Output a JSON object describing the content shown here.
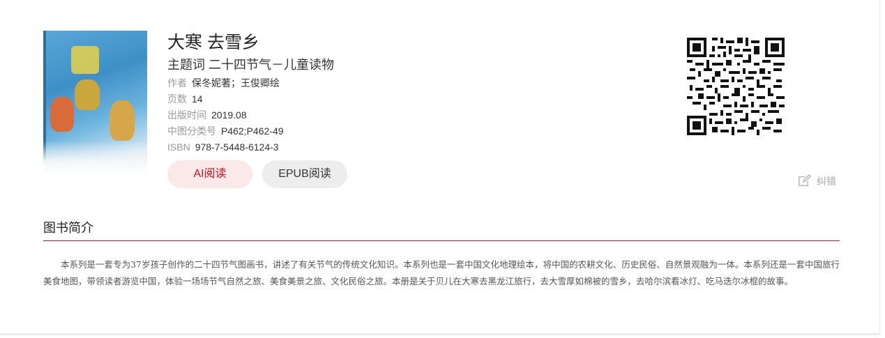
{
  "book": {
    "title": "大寒 去雪乡",
    "subject_label": "主题词",
    "subject_value": "二十四节气－儿童读物",
    "meta": [
      {
        "key": "作者",
        "value": "保冬妮著；王俊卿绘"
      },
      {
        "key": "页数",
        "value": "14"
      },
      {
        "key": "出版时间",
        "value": "2019.08"
      },
      {
        "key": "中图分类号",
        "value": "P462;P462-49"
      },
      {
        "key": "ISBN",
        "value": "978-7-5448-6124-3"
      }
    ],
    "cover_icon": "book-cover-image"
  },
  "actions": {
    "ai_read": "AI阅读",
    "epub_read": "EPUB阅读",
    "report_error": "纠错"
  },
  "qr_icon": "qr-code",
  "intro": {
    "heading": "图书简介",
    "text": "本系列是一套专为37岁孩子创作的二十四节气图画书，讲述了有关节气的传统文化知识。本系列也是一套中国文化地理绘本，将中国的农耕文化、历史民俗、自然景观融为一体。本系列还是一套中国旅行美食地图，带领读者游览中国，体验一场场节气自然之旅、美食美景之旅、文化民俗之旅。本册是关于贝儿在大寒去黑龙江旅行，去大雪厚如棉被的雪乡，去哈尔滨看冰灯、吃马迭尔冰棍的故事。"
  },
  "colors": {
    "accent": "#c4141b",
    "ai_button_bg": "#fbe9e9",
    "epub_button_bg": "#ededed",
    "muted_text": "#999999"
  }
}
